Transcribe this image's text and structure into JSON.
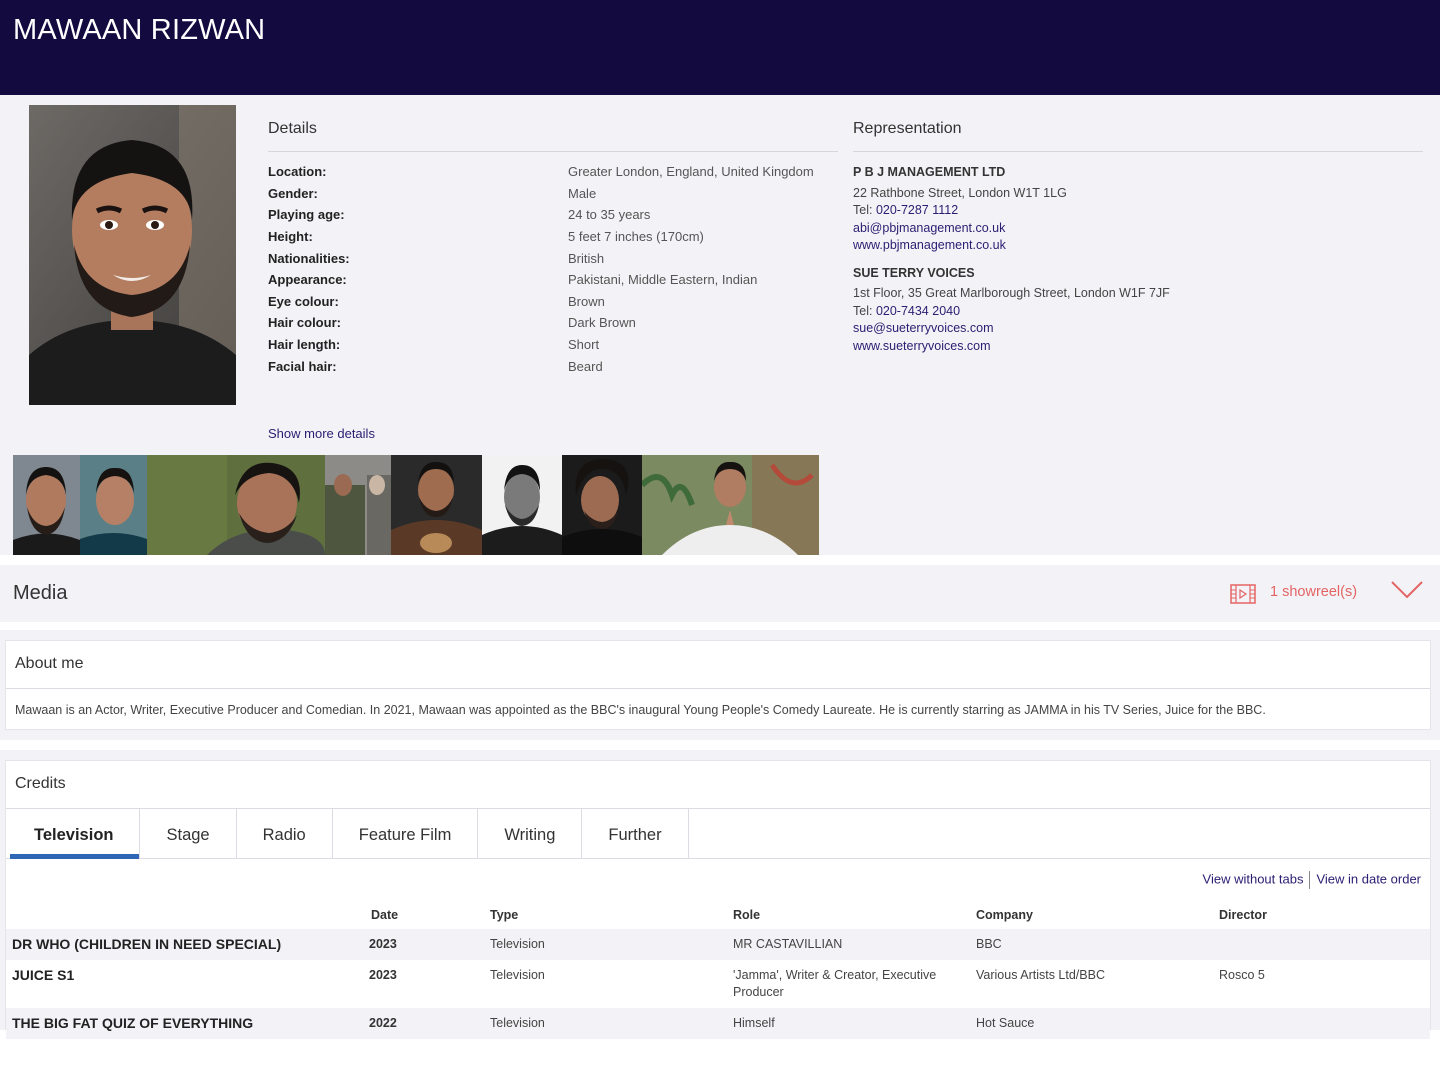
{
  "header": {
    "name": "MAWAAN RIZWAN"
  },
  "details": {
    "heading": "Details",
    "rows": [
      {
        "label": "Location:",
        "value": "Greater London, England, United Kingdom"
      },
      {
        "label": "Gender:",
        "value": "Male"
      },
      {
        "label": "Playing age:",
        "value": "24 to 35 years"
      },
      {
        "label": "Height:",
        "value": "5 feet 7 inches (170cm)"
      },
      {
        "label": "Nationalities:",
        "value": "British"
      },
      {
        "label": "Appearance:",
        "value": "Pakistani, Middle Eastern, Indian"
      },
      {
        "label": "Eye colour:",
        "value": "Brown"
      },
      {
        "label": "Hair colour:",
        "value": "Dark Brown"
      },
      {
        "label": "Hair length:",
        "value": "Short"
      },
      {
        "label": "Facial hair:",
        "value": "Beard"
      }
    ],
    "show_more": "Show more details"
  },
  "representation": {
    "heading": "Representation",
    "agencies": [
      {
        "name": "P B J MANAGEMENT LTD",
        "address": "22 Rathbone Street, London W1T 1LG",
        "tel_label": "Tel:",
        "tel": "020-7287 1112",
        "email": "abi@pbjmanagement.co.uk",
        "web": "www.pbjmanagement.co.uk"
      },
      {
        "name": "SUE TERRY VOICES",
        "address": "1st Floor, 35 Great Marlborough Street, London W1F 7JF",
        "tel_label": "Tel:",
        "tel": "020-7434 2040",
        "email": "sue@sueterryvoices.com",
        "web": "www.sueterryvoices.com"
      }
    ]
  },
  "media": {
    "title": "Media",
    "showreels": "1 showreel(s)",
    "icon": "film-icon",
    "expand_icon": "chevron-down-icon"
  },
  "about": {
    "heading": "About me",
    "text": "Mawaan is an Actor, Writer, Executive Producer and Comedian. In 2021, Mawaan was appointed as the BBC's inaugural Young People's Comedy Laureate. He is currently starring as JAMMA in his TV Series, Juice for the BBC."
  },
  "credits": {
    "heading": "Credits",
    "tabs": [
      "Television",
      "Stage",
      "Radio",
      "Feature Film",
      "Writing",
      "Further"
    ],
    "active_tab": "Television",
    "view_without_tabs": "View without tabs",
    "view_date_order": "View in date order",
    "columns": [
      "",
      "Date",
      "Type",
      "Role",
      "Company",
      "Director"
    ],
    "rows": [
      {
        "title": "DR WHO (CHILDREN IN NEED SPECIAL)",
        "date": "2023",
        "type": "Television",
        "role": "MR CASTAVILLIAN",
        "company": "BBC",
        "director": ""
      },
      {
        "title": "JUICE S1",
        "date": "2023",
        "type": "Television",
        "role": "'Jamma', Writer & Creator, Executive Producer",
        "company": "Various Artists Ltd/BBC",
        "director": "Rosco 5"
      },
      {
        "title": "THE BIG FAT QUIZ OF EVERYTHING",
        "date": "2022",
        "type": "Television",
        "role": "Himself",
        "company": "Hot Sauce",
        "director": ""
      }
    ]
  },
  "colors": {
    "header_bg": "#130a40",
    "link": "#2b1d72",
    "accent_red": "#e46464",
    "tab_underline": "#2f66b5"
  }
}
